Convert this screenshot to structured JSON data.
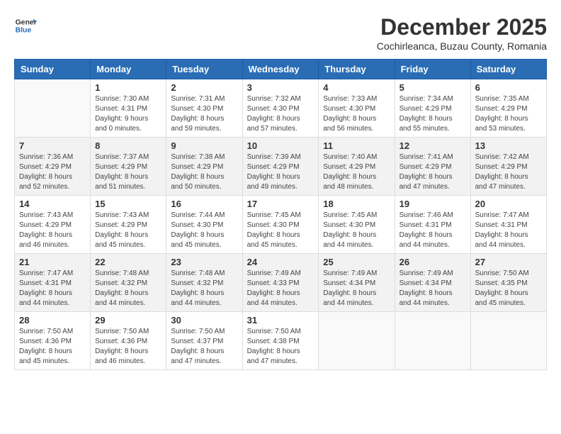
{
  "logo": {
    "general": "General",
    "blue": "Blue"
  },
  "title": "December 2025",
  "subtitle": "Cochirleanca, Buzau County, Romania",
  "days_header": [
    "Sunday",
    "Monday",
    "Tuesday",
    "Wednesday",
    "Thursday",
    "Friday",
    "Saturday"
  ],
  "weeks": [
    [
      {
        "day": "",
        "info": ""
      },
      {
        "day": "1",
        "info": "Sunrise: 7:30 AM\nSunset: 4:31 PM\nDaylight: 9 hours\nand 0 minutes."
      },
      {
        "day": "2",
        "info": "Sunrise: 7:31 AM\nSunset: 4:30 PM\nDaylight: 8 hours\nand 59 minutes."
      },
      {
        "day": "3",
        "info": "Sunrise: 7:32 AM\nSunset: 4:30 PM\nDaylight: 8 hours\nand 57 minutes."
      },
      {
        "day": "4",
        "info": "Sunrise: 7:33 AM\nSunset: 4:30 PM\nDaylight: 8 hours\nand 56 minutes."
      },
      {
        "day": "5",
        "info": "Sunrise: 7:34 AM\nSunset: 4:29 PM\nDaylight: 8 hours\nand 55 minutes."
      },
      {
        "day": "6",
        "info": "Sunrise: 7:35 AM\nSunset: 4:29 PM\nDaylight: 8 hours\nand 53 minutes."
      }
    ],
    [
      {
        "day": "7",
        "info": "Sunrise: 7:36 AM\nSunset: 4:29 PM\nDaylight: 8 hours\nand 52 minutes."
      },
      {
        "day": "8",
        "info": "Sunrise: 7:37 AM\nSunset: 4:29 PM\nDaylight: 8 hours\nand 51 minutes."
      },
      {
        "day": "9",
        "info": "Sunrise: 7:38 AM\nSunset: 4:29 PM\nDaylight: 8 hours\nand 50 minutes."
      },
      {
        "day": "10",
        "info": "Sunrise: 7:39 AM\nSunset: 4:29 PM\nDaylight: 8 hours\nand 49 minutes."
      },
      {
        "day": "11",
        "info": "Sunrise: 7:40 AM\nSunset: 4:29 PM\nDaylight: 8 hours\nand 48 minutes."
      },
      {
        "day": "12",
        "info": "Sunrise: 7:41 AM\nSunset: 4:29 PM\nDaylight: 8 hours\nand 47 minutes."
      },
      {
        "day": "13",
        "info": "Sunrise: 7:42 AM\nSunset: 4:29 PM\nDaylight: 8 hours\nand 47 minutes."
      }
    ],
    [
      {
        "day": "14",
        "info": "Sunrise: 7:43 AM\nSunset: 4:29 PM\nDaylight: 8 hours\nand 46 minutes."
      },
      {
        "day": "15",
        "info": "Sunrise: 7:43 AM\nSunset: 4:29 PM\nDaylight: 8 hours\nand 45 minutes."
      },
      {
        "day": "16",
        "info": "Sunrise: 7:44 AM\nSunset: 4:30 PM\nDaylight: 8 hours\nand 45 minutes."
      },
      {
        "day": "17",
        "info": "Sunrise: 7:45 AM\nSunset: 4:30 PM\nDaylight: 8 hours\nand 45 minutes."
      },
      {
        "day": "18",
        "info": "Sunrise: 7:45 AM\nSunset: 4:30 PM\nDaylight: 8 hours\nand 44 minutes."
      },
      {
        "day": "19",
        "info": "Sunrise: 7:46 AM\nSunset: 4:31 PM\nDaylight: 8 hours\nand 44 minutes."
      },
      {
        "day": "20",
        "info": "Sunrise: 7:47 AM\nSunset: 4:31 PM\nDaylight: 8 hours\nand 44 minutes."
      }
    ],
    [
      {
        "day": "21",
        "info": "Sunrise: 7:47 AM\nSunset: 4:31 PM\nDaylight: 8 hours\nand 44 minutes."
      },
      {
        "day": "22",
        "info": "Sunrise: 7:48 AM\nSunset: 4:32 PM\nDaylight: 8 hours\nand 44 minutes."
      },
      {
        "day": "23",
        "info": "Sunrise: 7:48 AM\nSunset: 4:32 PM\nDaylight: 8 hours\nand 44 minutes."
      },
      {
        "day": "24",
        "info": "Sunrise: 7:49 AM\nSunset: 4:33 PM\nDaylight: 8 hours\nand 44 minutes."
      },
      {
        "day": "25",
        "info": "Sunrise: 7:49 AM\nSunset: 4:34 PM\nDaylight: 8 hours\nand 44 minutes."
      },
      {
        "day": "26",
        "info": "Sunrise: 7:49 AM\nSunset: 4:34 PM\nDaylight: 8 hours\nand 44 minutes."
      },
      {
        "day": "27",
        "info": "Sunrise: 7:50 AM\nSunset: 4:35 PM\nDaylight: 8 hours\nand 45 minutes."
      }
    ],
    [
      {
        "day": "28",
        "info": "Sunrise: 7:50 AM\nSunset: 4:36 PM\nDaylight: 8 hours\nand 45 minutes."
      },
      {
        "day": "29",
        "info": "Sunrise: 7:50 AM\nSunset: 4:36 PM\nDaylight: 8 hours\nand 46 minutes."
      },
      {
        "day": "30",
        "info": "Sunrise: 7:50 AM\nSunset: 4:37 PM\nDaylight: 8 hours\nand 47 minutes."
      },
      {
        "day": "31",
        "info": "Sunrise: 7:50 AM\nSunset: 4:38 PM\nDaylight: 8 hours\nand 47 minutes."
      },
      {
        "day": "",
        "info": ""
      },
      {
        "day": "",
        "info": ""
      },
      {
        "day": "",
        "info": ""
      }
    ]
  ]
}
